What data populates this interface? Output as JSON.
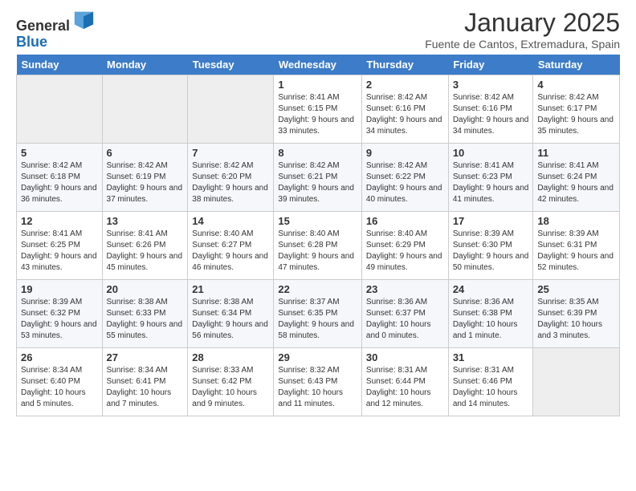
{
  "header": {
    "logo_general": "General",
    "logo_blue": "Blue",
    "month_title": "January 2025",
    "location": "Fuente de Cantos, Extremadura, Spain"
  },
  "weekdays": [
    "Sunday",
    "Monday",
    "Tuesday",
    "Wednesday",
    "Thursday",
    "Friday",
    "Saturday"
  ],
  "weeks": [
    [
      {
        "day": "",
        "empty": true
      },
      {
        "day": "",
        "empty": true
      },
      {
        "day": "",
        "empty": true
      },
      {
        "day": "1",
        "sunrise": "8:41 AM",
        "sunset": "6:15 PM",
        "daylight": "9 hours and 33 minutes."
      },
      {
        "day": "2",
        "sunrise": "8:42 AM",
        "sunset": "6:16 PM",
        "daylight": "9 hours and 34 minutes."
      },
      {
        "day": "3",
        "sunrise": "8:42 AM",
        "sunset": "6:16 PM",
        "daylight": "9 hours and 34 minutes."
      },
      {
        "day": "4",
        "sunrise": "8:42 AM",
        "sunset": "6:17 PM",
        "daylight": "9 hours and 35 minutes."
      }
    ],
    [
      {
        "day": "5",
        "sunrise": "8:42 AM",
        "sunset": "6:18 PM",
        "daylight": "9 hours and 36 minutes."
      },
      {
        "day": "6",
        "sunrise": "8:42 AM",
        "sunset": "6:19 PM",
        "daylight": "9 hours and 37 minutes."
      },
      {
        "day": "7",
        "sunrise": "8:42 AM",
        "sunset": "6:20 PM",
        "daylight": "9 hours and 38 minutes."
      },
      {
        "day": "8",
        "sunrise": "8:42 AM",
        "sunset": "6:21 PM",
        "daylight": "9 hours and 39 minutes."
      },
      {
        "day": "9",
        "sunrise": "8:42 AM",
        "sunset": "6:22 PM",
        "daylight": "9 hours and 40 minutes."
      },
      {
        "day": "10",
        "sunrise": "8:41 AM",
        "sunset": "6:23 PM",
        "daylight": "9 hours and 41 minutes."
      },
      {
        "day": "11",
        "sunrise": "8:41 AM",
        "sunset": "6:24 PM",
        "daylight": "9 hours and 42 minutes."
      }
    ],
    [
      {
        "day": "12",
        "sunrise": "8:41 AM",
        "sunset": "6:25 PM",
        "daylight": "9 hours and 43 minutes."
      },
      {
        "day": "13",
        "sunrise": "8:41 AM",
        "sunset": "6:26 PM",
        "daylight": "9 hours and 45 minutes."
      },
      {
        "day": "14",
        "sunrise": "8:40 AM",
        "sunset": "6:27 PM",
        "daylight": "9 hours and 46 minutes."
      },
      {
        "day": "15",
        "sunrise": "8:40 AM",
        "sunset": "6:28 PM",
        "daylight": "9 hours and 47 minutes."
      },
      {
        "day": "16",
        "sunrise": "8:40 AM",
        "sunset": "6:29 PM",
        "daylight": "9 hours and 49 minutes."
      },
      {
        "day": "17",
        "sunrise": "8:39 AM",
        "sunset": "6:30 PM",
        "daylight": "9 hours and 50 minutes."
      },
      {
        "day": "18",
        "sunrise": "8:39 AM",
        "sunset": "6:31 PM",
        "daylight": "9 hours and 52 minutes."
      }
    ],
    [
      {
        "day": "19",
        "sunrise": "8:39 AM",
        "sunset": "6:32 PM",
        "daylight": "9 hours and 53 minutes."
      },
      {
        "day": "20",
        "sunrise": "8:38 AM",
        "sunset": "6:33 PM",
        "daylight": "9 hours and 55 minutes."
      },
      {
        "day": "21",
        "sunrise": "8:38 AM",
        "sunset": "6:34 PM",
        "daylight": "9 hours and 56 minutes."
      },
      {
        "day": "22",
        "sunrise": "8:37 AM",
        "sunset": "6:35 PM",
        "daylight": "9 hours and 58 minutes."
      },
      {
        "day": "23",
        "sunrise": "8:36 AM",
        "sunset": "6:37 PM",
        "daylight": "10 hours and 0 minutes."
      },
      {
        "day": "24",
        "sunrise": "8:36 AM",
        "sunset": "6:38 PM",
        "daylight": "10 hours and 1 minute."
      },
      {
        "day": "25",
        "sunrise": "8:35 AM",
        "sunset": "6:39 PM",
        "daylight": "10 hours and 3 minutes."
      }
    ],
    [
      {
        "day": "26",
        "sunrise": "8:34 AM",
        "sunset": "6:40 PM",
        "daylight": "10 hours and 5 minutes."
      },
      {
        "day": "27",
        "sunrise": "8:34 AM",
        "sunset": "6:41 PM",
        "daylight": "10 hours and 7 minutes."
      },
      {
        "day": "28",
        "sunrise": "8:33 AM",
        "sunset": "6:42 PM",
        "daylight": "10 hours and 9 minutes."
      },
      {
        "day": "29",
        "sunrise": "8:32 AM",
        "sunset": "6:43 PM",
        "daylight": "10 hours and 11 minutes."
      },
      {
        "day": "30",
        "sunrise": "8:31 AM",
        "sunset": "6:44 PM",
        "daylight": "10 hours and 12 minutes."
      },
      {
        "day": "31",
        "sunrise": "8:31 AM",
        "sunset": "6:46 PM",
        "daylight": "10 hours and 14 minutes."
      },
      {
        "day": "",
        "empty": true
      }
    ]
  ]
}
